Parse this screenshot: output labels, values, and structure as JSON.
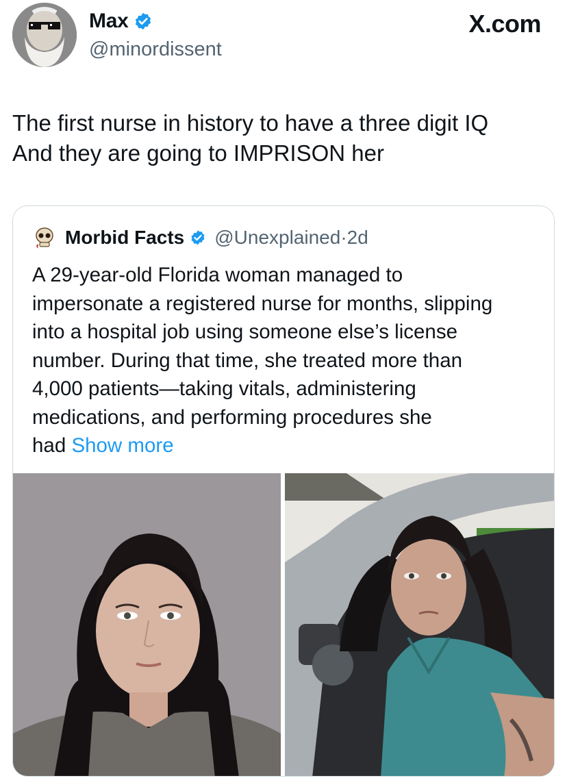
{
  "header": {
    "display_name": "Max",
    "handle": "@minordissent",
    "brand": "X.com",
    "avatar_icon": "sunglasses-old-man-avatar-icon",
    "verified_icon": "verified-badge-icon"
  },
  "tweet": {
    "line1": "The first nurse in history to have a three digit IQ",
    "line2": "And they are going to IMPRISON her"
  },
  "quote": {
    "display_name": "Morbid Facts",
    "handle": "@Unexplained",
    "separator": "·",
    "age": "2d",
    "avatar_icon": "skull-avatar-icon",
    "verified_icon": "verified-badge-icon",
    "body_lines": [
      "A 29-year-old Florida woman managed to",
      "impersonate a registered nurse for months, slipping",
      "into a hospital job using someone else’s license",
      "number. During that time, she treated more than",
      "4,000 patients—taking vitals, administering",
      "medications, and performing procedures she"
    ],
    "last_line_prefix": "had",
    "show_more": "Show more",
    "photos": [
      {
        "description_icon": "mugshot-photo"
      },
      {
        "description_icon": "car-door-bodycam-photo"
      }
    ]
  },
  "colors": {
    "text": "#0f1419",
    "secondary": "#536471",
    "link": "#1d9bf0",
    "border": "#cfd9de"
  }
}
